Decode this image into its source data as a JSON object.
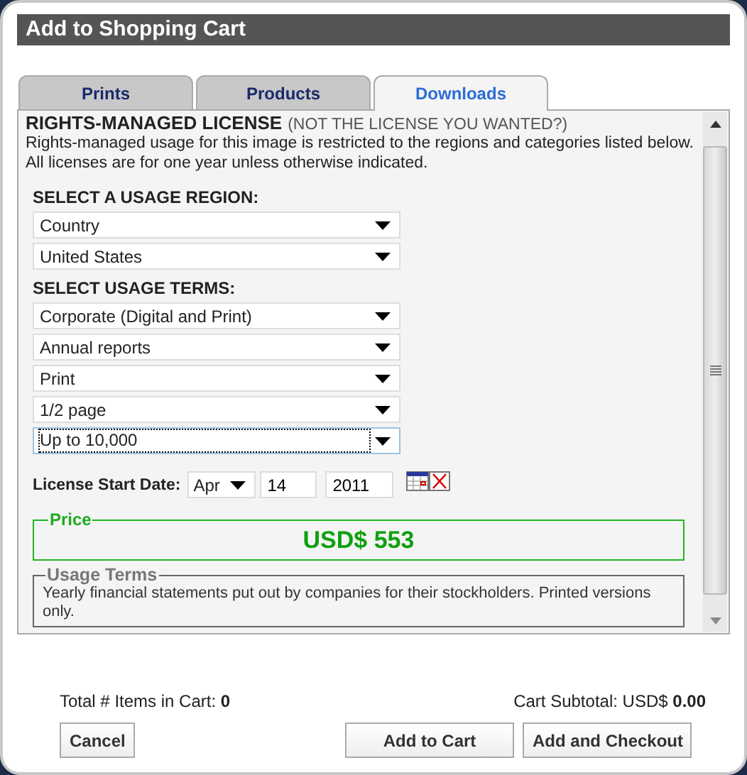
{
  "window": {
    "title": "Add to Shopping Cart"
  },
  "tabs": [
    {
      "label": "Prints",
      "selected": false
    },
    {
      "label": "Products",
      "selected": false
    },
    {
      "label": "Downloads",
      "selected": true
    }
  ],
  "license": {
    "heading": "RIGHTS-MANAGED LICENSE",
    "link": "(NOT THE LICENSE YOU WANTED?)",
    "description": [
      "Rights-managed usage for this image is restricted to the regions and categories listed below.",
      "All licenses are for one year unless otherwise indicated."
    ]
  },
  "region": {
    "heading": "SELECT A USAGE REGION:",
    "selects": [
      {
        "value": "Country",
        "focused": false
      },
      {
        "value": "United States",
        "focused": false
      }
    ]
  },
  "terms": {
    "heading": "SELECT USAGE TERMS:",
    "selects": [
      {
        "value": "Corporate (Digital and Print)",
        "focused": false
      },
      {
        "value": "Annual reports",
        "focused": false
      },
      {
        "value": "Print",
        "focused": false
      },
      {
        "value": "1/2 page",
        "focused": false
      },
      {
        "value": "Up to 10,000",
        "focused": true
      }
    ]
  },
  "start_date": {
    "label": "License Start Date:",
    "month": "Apr",
    "day": "14",
    "year": "2011"
  },
  "price": {
    "legend": "Price",
    "amount": "USD$ 553"
  },
  "usage_terms": {
    "legend": "Usage Terms",
    "text": "Yearly financial statements put out by companies for their stockholders. Printed versions only."
  },
  "footer": {
    "items_label": "Total # Items in Cart:",
    "items_count": "0",
    "subtotal_label": "Cart Subtotal: USD$",
    "subtotal": "0.00"
  },
  "buttons": [
    {
      "label": "Cancel"
    },
    {
      "label": "Add to Cart"
    },
    {
      "label": "Add and Checkout"
    }
  ]
}
